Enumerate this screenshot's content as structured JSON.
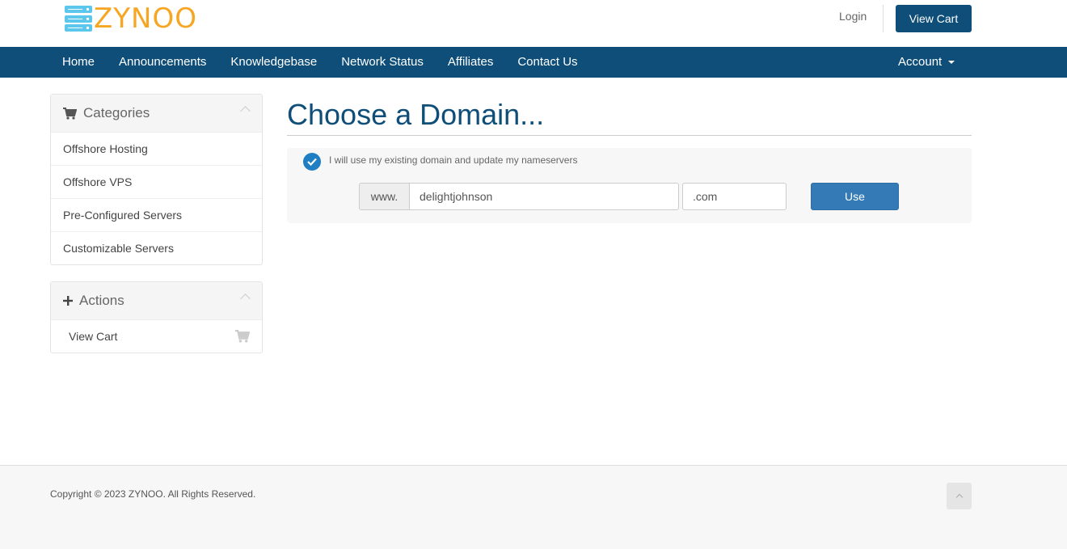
{
  "header": {
    "logo_text": "ZYNOO",
    "login_label": "Login",
    "view_cart_label": "View Cart"
  },
  "nav": {
    "items": [
      {
        "label": "Home"
      },
      {
        "label": "Announcements"
      },
      {
        "label": "Knowledgebase"
      },
      {
        "label": "Network Status"
      },
      {
        "label": "Affiliates"
      },
      {
        "label": "Contact Us"
      }
    ],
    "account_label": "Account"
  },
  "sidebar": {
    "categories": {
      "title": "Categories",
      "icon": "shopping-cart-icon",
      "items": [
        {
          "label": "Offshore Hosting"
        },
        {
          "label": "Offshore VPS"
        },
        {
          "label": "Pre-Configured Servers"
        },
        {
          "label": "Customizable Servers"
        }
      ]
    },
    "actions": {
      "title": "Actions",
      "icon": "plus-icon",
      "items": [
        {
          "label": "View Cart",
          "icon": "shopping-cart-icon"
        }
      ]
    }
  },
  "main": {
    "title": "Choose a Domain...",
    "option_label": "I will use my existing domain and update my nameservers",
    "www_prefix": "www.",
    "sld_value": "delightjohnson",
    "tld_value": ".com",
    "use_button_label": "Use"
  },
  "footer": {
    "copyright": "Copyright © 2023 ZYNOO. All Rights Reserved."
  },
  "colors": {
    "brand_primary": "#0e4e78",
    "logo_orange": "#f6a623",
    "logo_blue": "#5bc7ec",
    "button_blue": "#337ab7"
  }
}
